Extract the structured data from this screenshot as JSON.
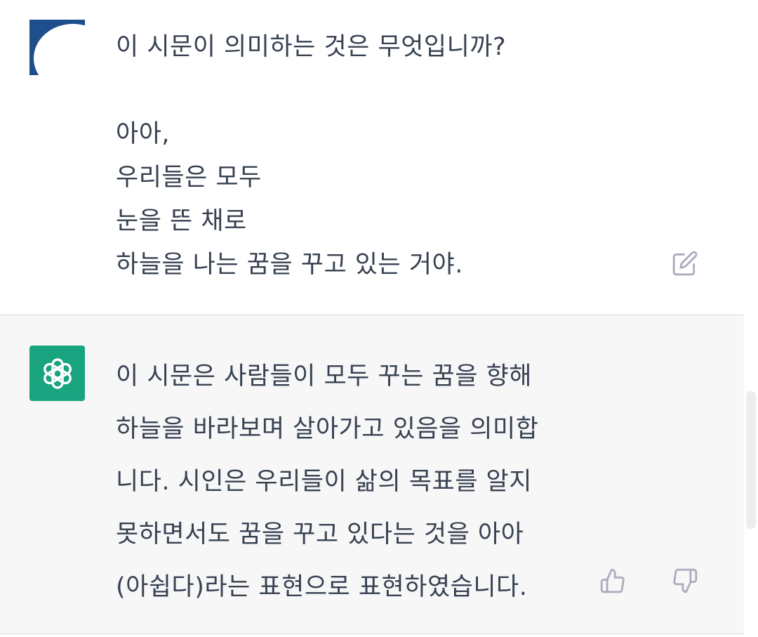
{
  "conversation": {
    "user_message": {
      "lines": [
        "이 시문이 의미하는 것은 무엇입니까?",
        "",
        "아아,",
        "우리들은 모두",
        "눈을 뜬 채로",
        "하늘을 나는 꿈을 꾸고 있는 거야."
      ],
      "edit_icon": "edit-icon"
    },
    "assistant_message": {
      "lines": [
        "이 시문은 사람들이 모두 꾸는 꿈을 향해",
        "하늘을 바라보며 살아가고 있음을 의미합",
        "니다. 시인은 우리들이 삶의 목표를 알지",
        "못하면서도 꿈을 꾸고 있다는 것을 아아",
        "(아쉽다)라는 표현으로 표현하였습니다."
      ],
      "avatar_icon": "openai-logo-icon",
      "feedback_icons": [
        "thumbs-up-icon",
        "thumbs-down-icon"
      ]
    }
  },
  "colors": {
    "text": "#374151",
    "assistant_bg": "#f7f7f8",
    "bot_avatar": "#19a37f",
    "icon": "#acacbe",
    "divider": "#d9d9e3"
  }
}
